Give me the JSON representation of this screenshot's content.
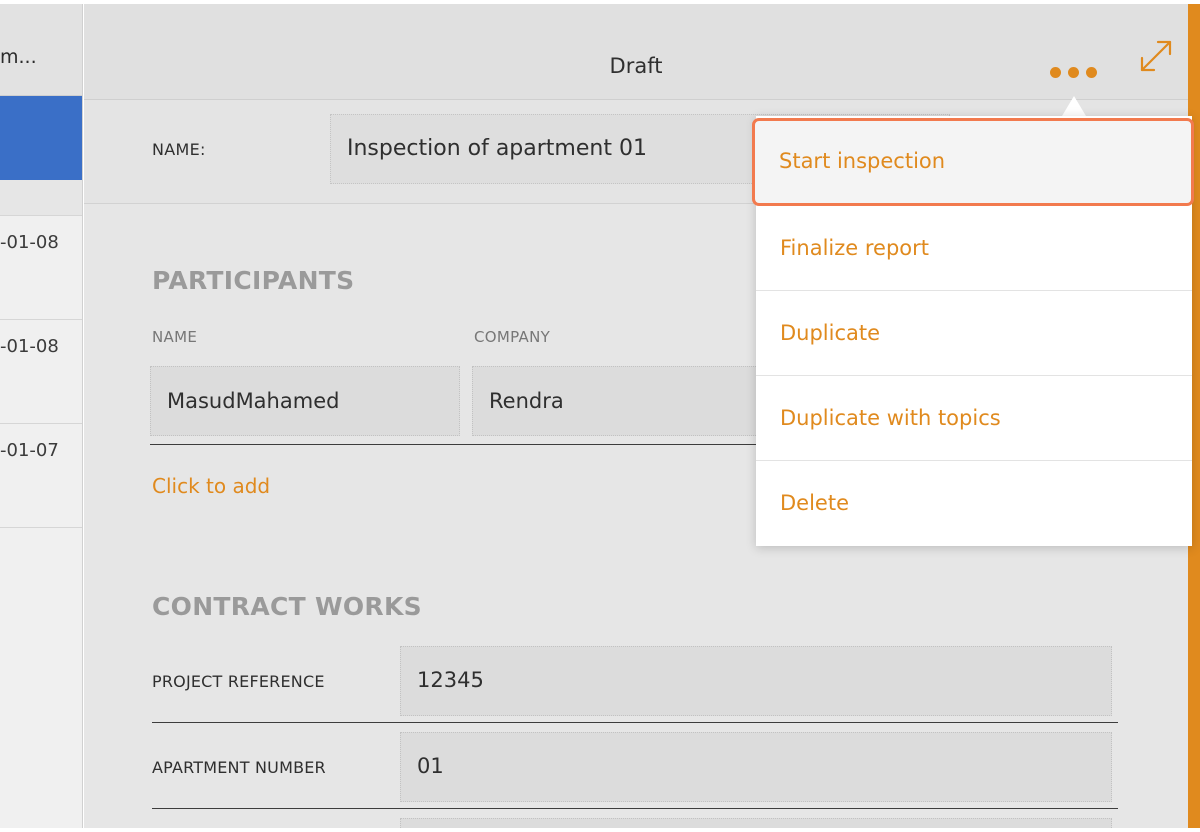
{
  "left_list": {
    "header_text": "m...",
    "rows": [
      {
        "date": "-01-08"
      },
      {
        "date": "-01-08"
      },
      {
        "date": "-01-07"
      }
    ]
  },
  "header": {
    "status": "Draft"
  },
  "name_section": {
    "label": "NAME:",
    "value": "Inspection of apartment 01"
  },
  "participants": {
    "title": "PARTICIPANTS",
    "col_name": "NAME",
    "col_company": "COMPANY",
    "rows": [
      {
        "name": "MasudMahamed",
        "company": "Rendra"
      }
    ],
    "add_label": "Click to add"
  },
  "contract_works": {
    "title": "CONTRACT WORKS",
    "fields": [
      {
        "label": "PROJECT REFERENCE",
        "value": "12345"
      },
      {
        "label": "APARTMENT NUMBER",
        "value": "01"
      }
    ]
  },
  "menu": {
    "items": [
      {
        "label": "Start inspection"
      },
      {
        "label": "Finalize report"
      },
      {
        "label": "Duplicate"
      },
      {
        "label": "Duplicate with topics"
      },
      {
        "label": "Delete"
      }
    ]
  },
  "colors": {
    "accent": "#e08a1e",
    "selected_row": "#3a6fc7",
    "highlight_border": "#f27a4e"
  },
  "icons": {
    "more": "more-horizontal-icon",
    "expand": "expand-icon"
  }
}
